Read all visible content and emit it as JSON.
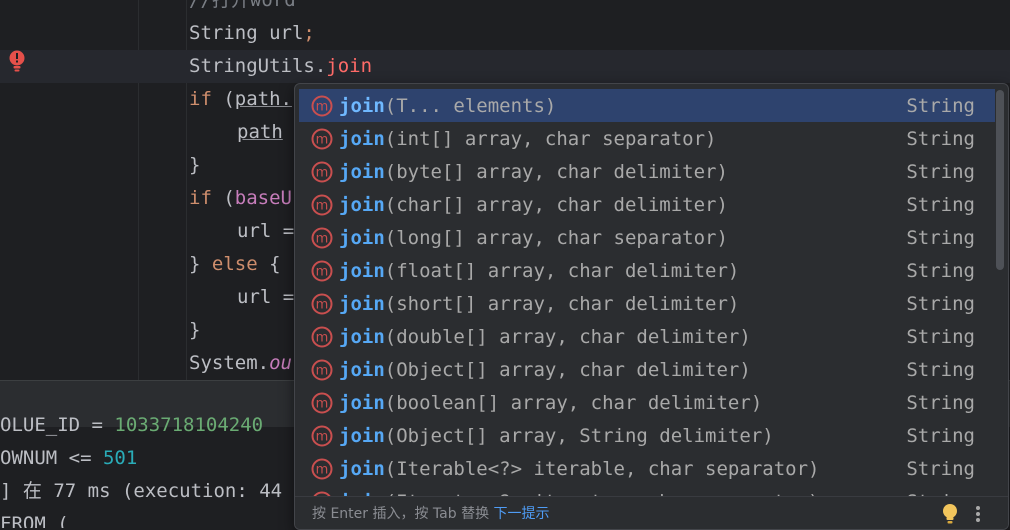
{
  "editor": {
    "lines": [
      {
        "comment": "//打开word"
      },
      {
        "a": "String url",
        "b": ";"
      },
      {
        "a": "StringUtils.",
        "b": "join"
      },
      {
        "kw": "if",
        "a": " (",
        "b": "path."
      },
      {
        "a": "path"
      },
      {
        "a": "}"
      },
      {
        "kw": "if",
        "a": " (",
        "b": "baseU"
      },
      {
        "a": "url ="
      },
      {
        "a": "} ",
        "kw": "else",
        "b": " {"
      },
      {
        "a": "url ="
      },
      {
        "a": "}"
      },
      {
        "a": "System.",
        "b": "ou"
      }
    ]
  },
  "console": {
    "line1_a": "OLUE_ID = ",
    "line1_b": "1033718104240",
    "line2_a": "OWNUM <= ",
    "line2_b": "501",
    "line3": "] 在 77 ms (execution: 44",
    "line4": "FROM ("
  },
  "autocomplete": {
    "items": [
      {
        "name": "join",
        "params": "(T... elements)",
        "type": "String"
      },
      {
        "name": "join",
        "params": "(int[] array, char separator)",
        "type": "String"
      },
      {
        "name": "join",
        "params": "(byte[] array, char delimiter)",
        "type": "String"
      },
      {
        "name": "join",
        "params": "(char[] array, char delimiter)",
        "type": "String"
      },
      {
        "name": "join",
        "params": "(long[] array, char separator)",
        "type": "String"
      },
      {
        "name": "join",
        "params": "(float[] array, char delimiter)",
        "type": "String"
      },
      {
        "name": "join",
        "params": "(short[] array, char delimiter)",
        "type": "String"
      },
      {
        "name": "join",
        "params": "(double[] array, char delimiter)",
        "type": "String"
      },
      {
        "name": "join",
        "params": "(Object[] array, char delimiter)",
        "type": "String"
      },
      {
        "name": "join",
        "params": "(boolean[] array, char delimiter)",
        "type": "String"
      },
      {
        "name": "join",
        "params": "(Object[] array, String delimiter)",
        "type": "String"
      },
      {
        "name": "join",
        "params": "(Iterable<?> iterable, char separator)",
        "type": "String"
      },
      {
        "name": "join",
        "params": "(Iterator<?> iterator, char separator)",
        "type": "String"
      }
    ],
    "icon_letter": "m",
    "hint_prefix": "按 Enter 插入，按 Tab 替换 ",
    "hint_link": "下一提示"
  },
  "colors": {
    "selection": "#2e436e",
    "method_icon": "#c94f4f",
    "accent_link": "#4f9cf5"
  }
}
